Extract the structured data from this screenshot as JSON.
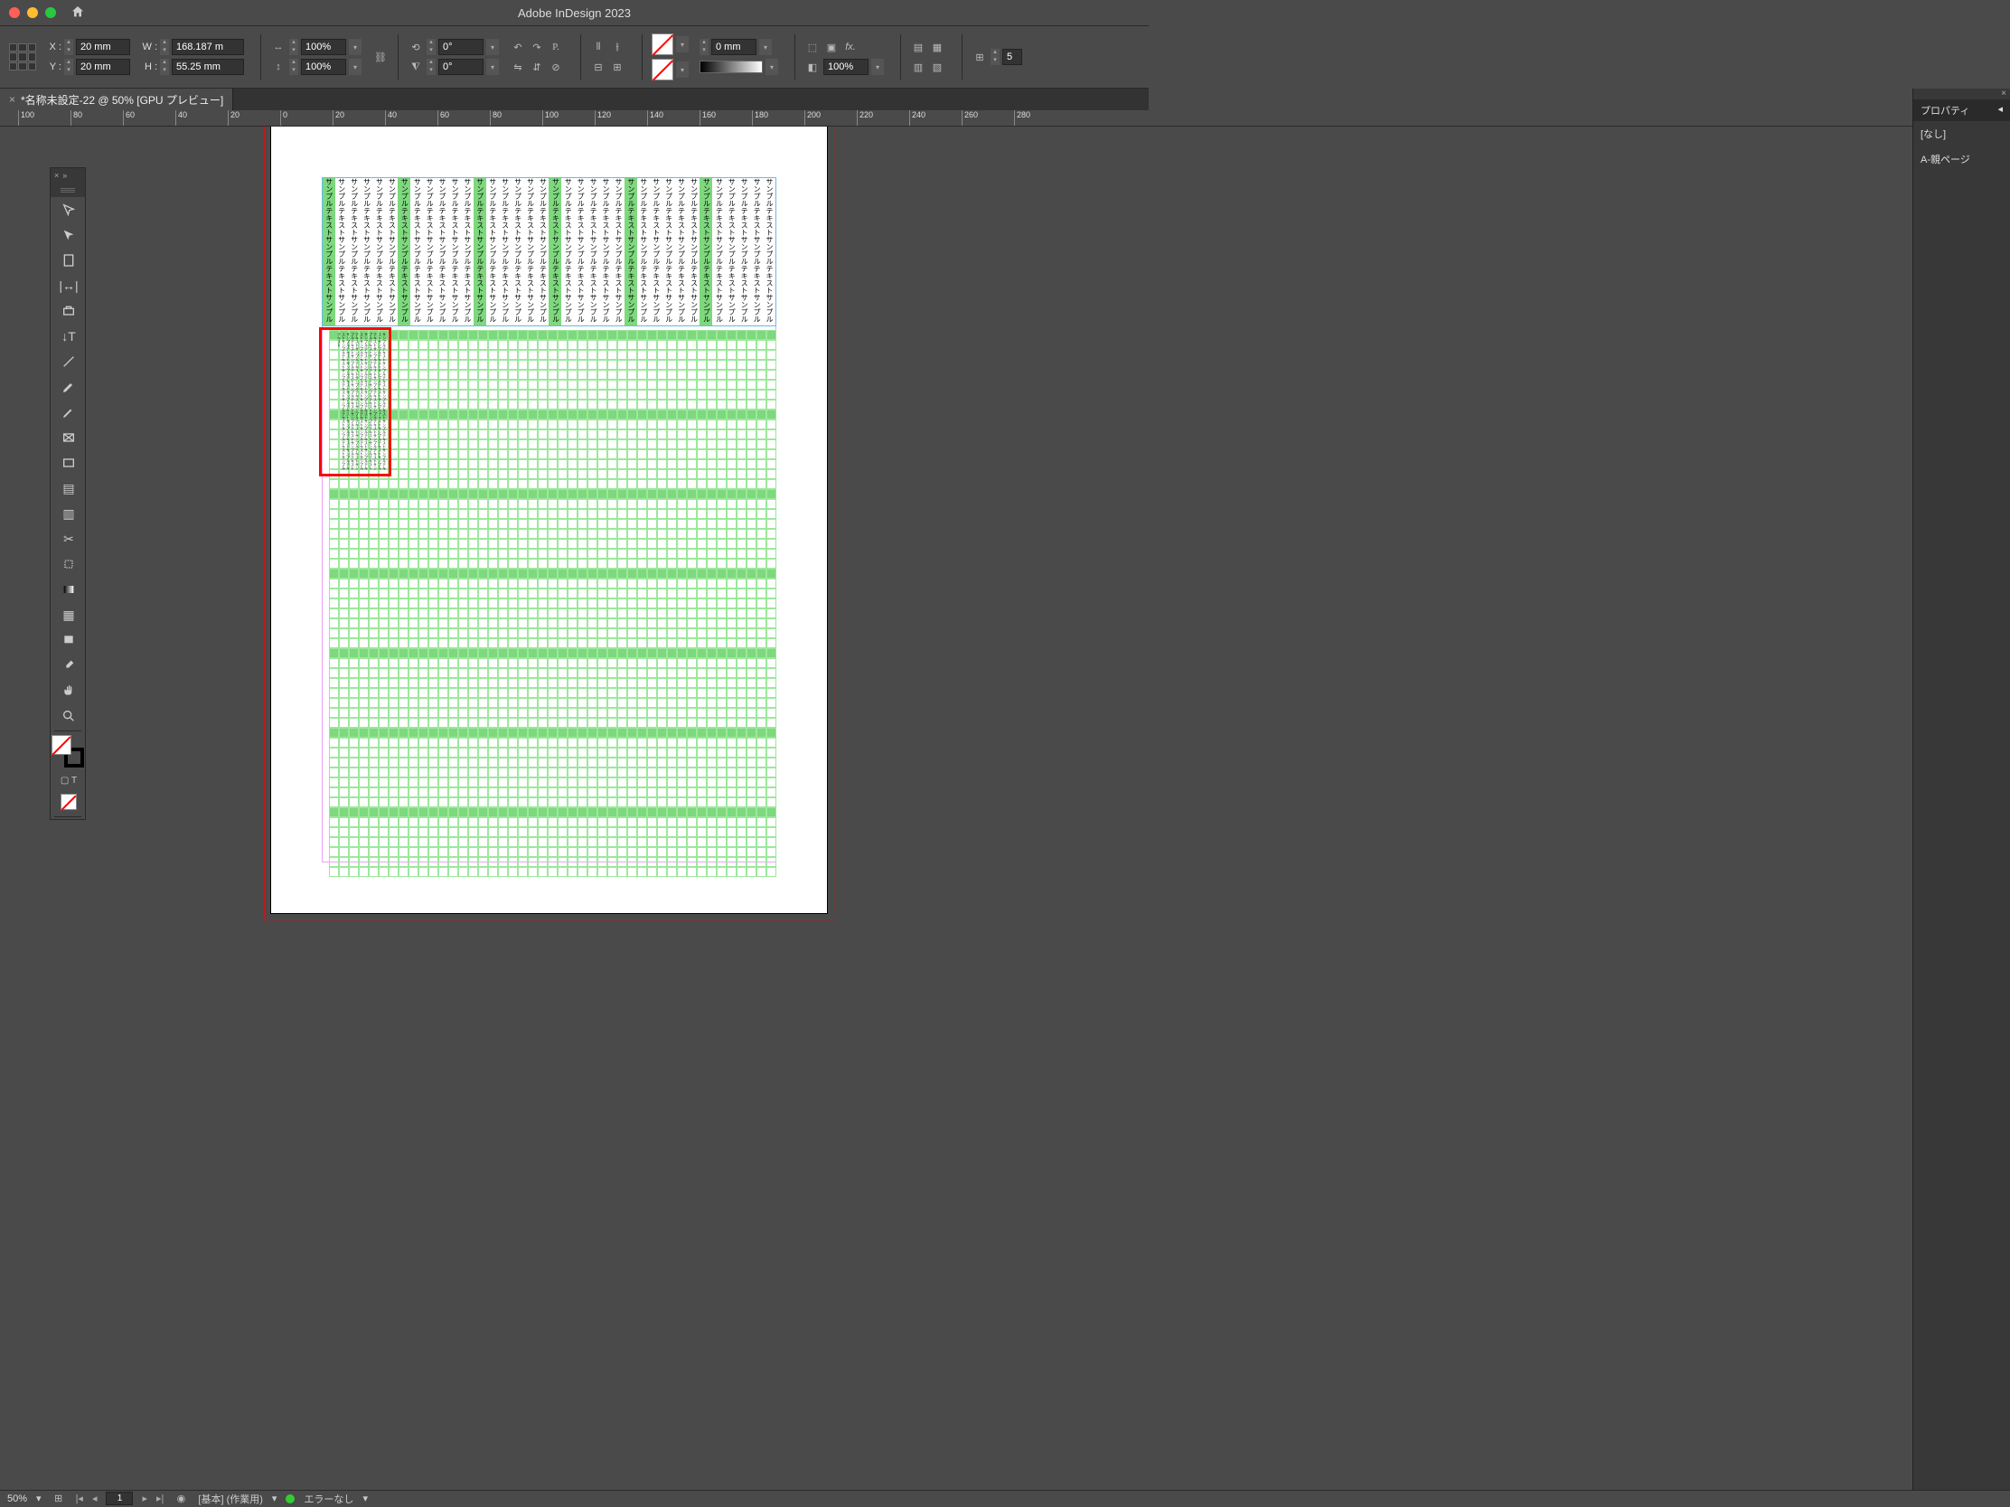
{
  "app": {
    "title": "Adobe InDesign 2023"
  },
  "document": {
    "tab_title": "*名称未設定-22 @ 50% [GPU プレビュー]"
  },
  "control": {
    "x_label": "X :",
    "x": "20 mm",
    "y_label": "Y :",
    "y": "20 mm",
    "w_label": "W :",
    "w": "168.187 m",
    "h_label": "H :",
    "h": "55.25 mm",
    "scale_x": "100%",
    "scale_y": "100%",
    "rotate": "0°",
    "shear": "0°",
    "stroke_weight": "0 mm",
    "opacity": "100%",
    "gap_value": "5"
  },
  "ruler": {
    "marks": [
      "100",
      "80",
      "60",
      "40",
      "20",
      "0",
      "20",
      "40",
      "60",
      "80",
      "100",
      "120",
      "140",
      "160",
      "180",
      "200",
      "220",
      "240",
      "260",
      "280"
    ]
  },
  "text": {
    "sample": "サンプルテキストサンプルテキストサンプルテキストサンプルテキスト"
  },
  "properties": {
    "tab": "プロパティ",
    "selection": "[なし]",
    "parent_page": "A-親ページ"
  },
  "status": {
    "zoom": "50%",
    "page": "1",
    "style_label": "[基本] (作業用)",
    "error_label": "エラーなし"
  }
}
